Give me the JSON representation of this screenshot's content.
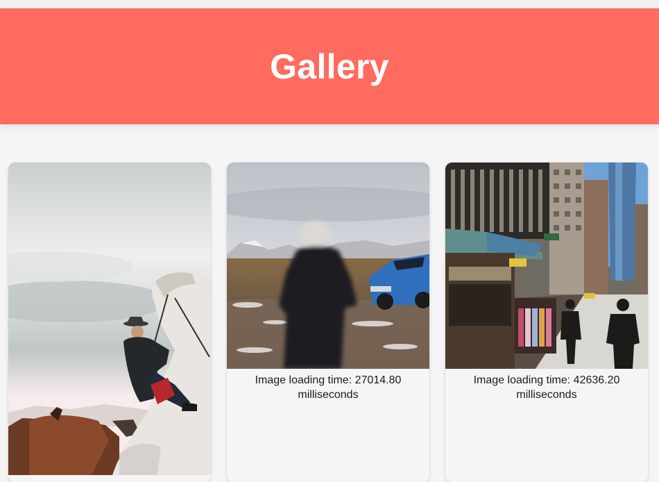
{
  "header": {
    "title": "Gallery"
  },
  "gallery": {
    "items": [
      {
        "photo": "cowboy-on-white-horse-photo",
        "caption": ""
      },
      {
        "photo": "person-in-winter-coat-photo",
        "caption": "Image loading time: 27014.80 milliseconds"
      },
      {
        "photo": "city-street-scene-photo",
        "caption": "Image loading time: 42636.20 milliseconds"
      }
    ]
  },
  "colors": {
    "header_bg": "#ff6b5e",
    "header_text": "#ffffff",
    "page_bg": "#f5f5f5",
    "caption_text": "#1a1a1a"
  }
}
